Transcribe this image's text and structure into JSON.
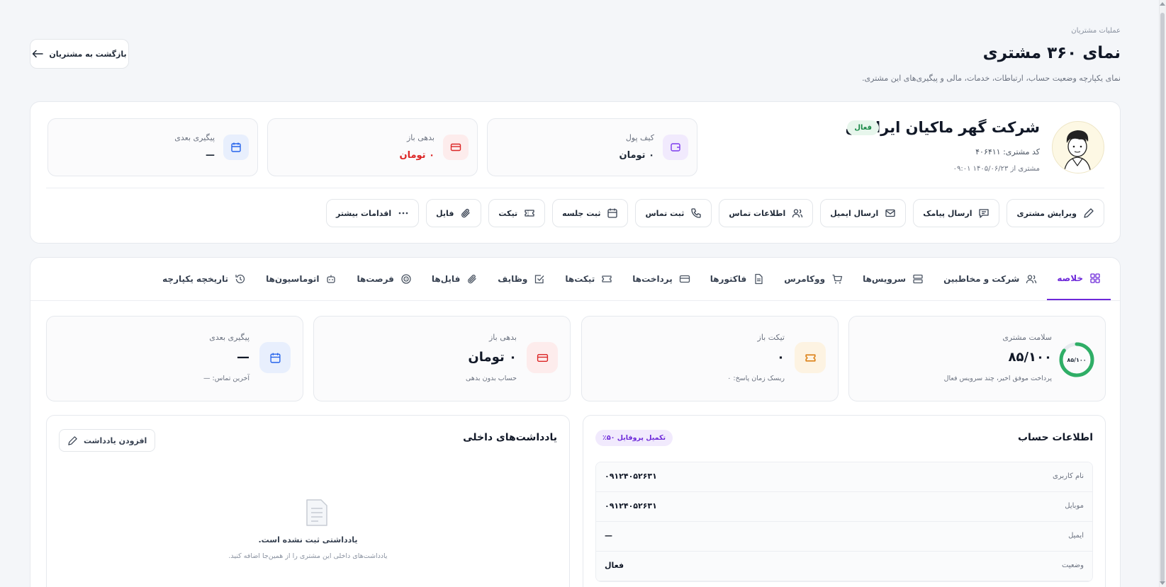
{
  "header": {
    "breadcrumb": "عملیات مشتریان",
    "title": "نمای ۳۶۰ مشتری",
    "subtitle": "نمای یکپارچه وضعیت حساب، ارتباطات، خدمات، مالی و پیگیری‌های این مشتری.",
    "back_label": "بازگشت به مشتریان"
  },
  "customer": {
    "name": "شرکت گهر ماکیان ایرانیان",
    "status": "فعال",
    "code": "کد مشتری: ۴۰۶۴۱۱",
    "since": "مشتری از ۱۴۰۵/۰۶/۲۳ ۰۹:۰۱"
  },
  "stats": [
    {
      "label": "کیف پول",
      "value": "۰ تومان",
      "icon": "wallet-icon",
      "color": "#7c3aed"
    },
    {
      "label": "بدهی باز",
      "value": "۰ تومان",
      "icon": "credit-card-icon",
      "color": "#dc2626"
    },
    {
      "label": "پیگیری بعدی",
      "value": "—",
      "icon": "calendar-icon",
      "color": "#2563eb"
    }
  ],
  "actions": [
    {
      "label": "ویرایش مشتری",
      "icon": "pencil-icon"
    },
    {
      "label": "ارسال پیامک",
      "icon": "message-icon"
    },
    {
      "label": "ارسال ایمیل",
      "icon": "mail-icon"
    },
    {
      "label": "اطلاعات تماس",
      "icon": "users-icon"
    },
    {
      "label": "ثبت تماس",
      "icon": "phone-icon"
    },
    {
      "label": "ثبت جلسه",
      "icon": "calendar-icon"
    },
    {
      "label": "تیکت",
      "icon": "ticket-icon"
    },
    {
      "label": "فایل",
      "icon": "paperclip-icon"
    },
    {
      "label": "اقدامات بیشتر",
      "icon": "more-icon"
    }
  ],
  "tabs": [
    {
      "label": "خلاصه",
      "icon": "grid-icon",
      "active": true
    },
    {
      "label": "شرکت و مخاطبین",
      "icon": "users-icon"
    },
    {
      "label": "سرویس‌ها",
      "icon": "server-icon"
    },
    {
      "label": "ووکامرس",
      "icon": "cart-icon"
    },
    {
      "label": "فاکتورها",
      "icon": "file-icon"
    },
    {
      "label": "پرداخت‌ها",
      "icon": "credit-card-icon"
    },
    {
      "label": "تیکت‌ها",
      "icon": "ticket-icon"
    },
    {
      "label": "وظایف",
      "icon": "check-square-icon"
    },
    {
      "label": "فایل‌ها",
      "icon": "paperclip-icon"
    },
    {
      "label": "فرصت‌ها",
      "icon": "target-icon"
    },
    {
      "label": "اتوماسیون‌ها",
      "icon": "robot-icon"
    },
    {
      "label": "تاریخچه یکپارچه",
      "icon": "history-icon"
    }
  ],
  "kpis": {
    "health": {
      "label": "سلامت مشتری",
      "value": "۸۵/۱۰۰",
      "ring_label": "۸۵/۱۰۰",
      "score": 0.85,
      "sub": "پرداخت موفق اخیر، چند سرویس فعال",
      "color": "#2fae66"
    },
    "tickets": {
      "label": "تیکت باز",
      "value": "۰",
      "sub": "ریسک زمان پاسخ: ۰",
      "color": "#d97706"
    },
    "debt": {
      "label": "بدهی باز",
      "value": "۰ تومان",
      "sub": "حساب بدون بدهی",
      "color": "#dc2626"
    },
    "followup": {
      "label": "پیگیری بعدی",
      "value": "—",
      "sub": "آخرین تماس: —",
      "color": "#2563eb"
    }
  },
  "account": {
    "title": "اطلاعات حساب",
    "completion": "تکمیل پروفایل ۵۰٪",
    "rows": [
      {
        "key": "نام کاربری",
        "value": "۰۹۱۲۴۰۵۲۶۳۱"
      },
      {
        "key": "موبایل",
        "value": "۰۹۱۲۴۰۵۲۶۳۱"
      },
      {
        "key": "ایمیل",
        "value": "—"
      },
      {
        "key": "وضعیت",
        "value": "فعال"
      }
    ]
  },
  "notes": {
    "title": "یادداشت‌های داخلی",
    "add_label": "افزودن یادداشت",
    "empty_title": "یادداشتی ثبت نشده است.",
    "empty_sub": "یادداشت‌های داخلی این مشتری را از همین‌جا اضافه کنید."
  }
}
